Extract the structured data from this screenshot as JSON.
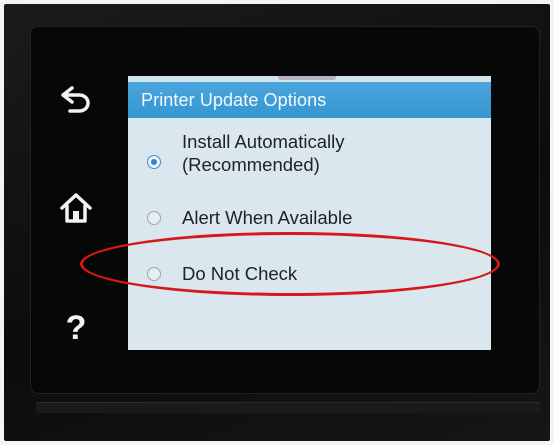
{
  "screen": {
    "title": "Printer Update Options",
    "options": [
      {
        "line1": "Install Automatically",
        "line2": "(Recommended)",
        "selected": true
      },
      {
        "line1": "Alert When Available",
        "selected": false
      },
      {
        "line1": "Do Not Check",
        "selected": false
      }
    ]
  },
  "nav": {
    "icons": [
      "back-arrow-icon",
      "home-icon",
      "help-icon"
    ],
    "help_glyph": "?"
  },
  "colors": {
    "titlebar": "#3596d2",
    "screen_bg": "#dbe7ee",
    "annotation": "#d6171c"
  }
}
